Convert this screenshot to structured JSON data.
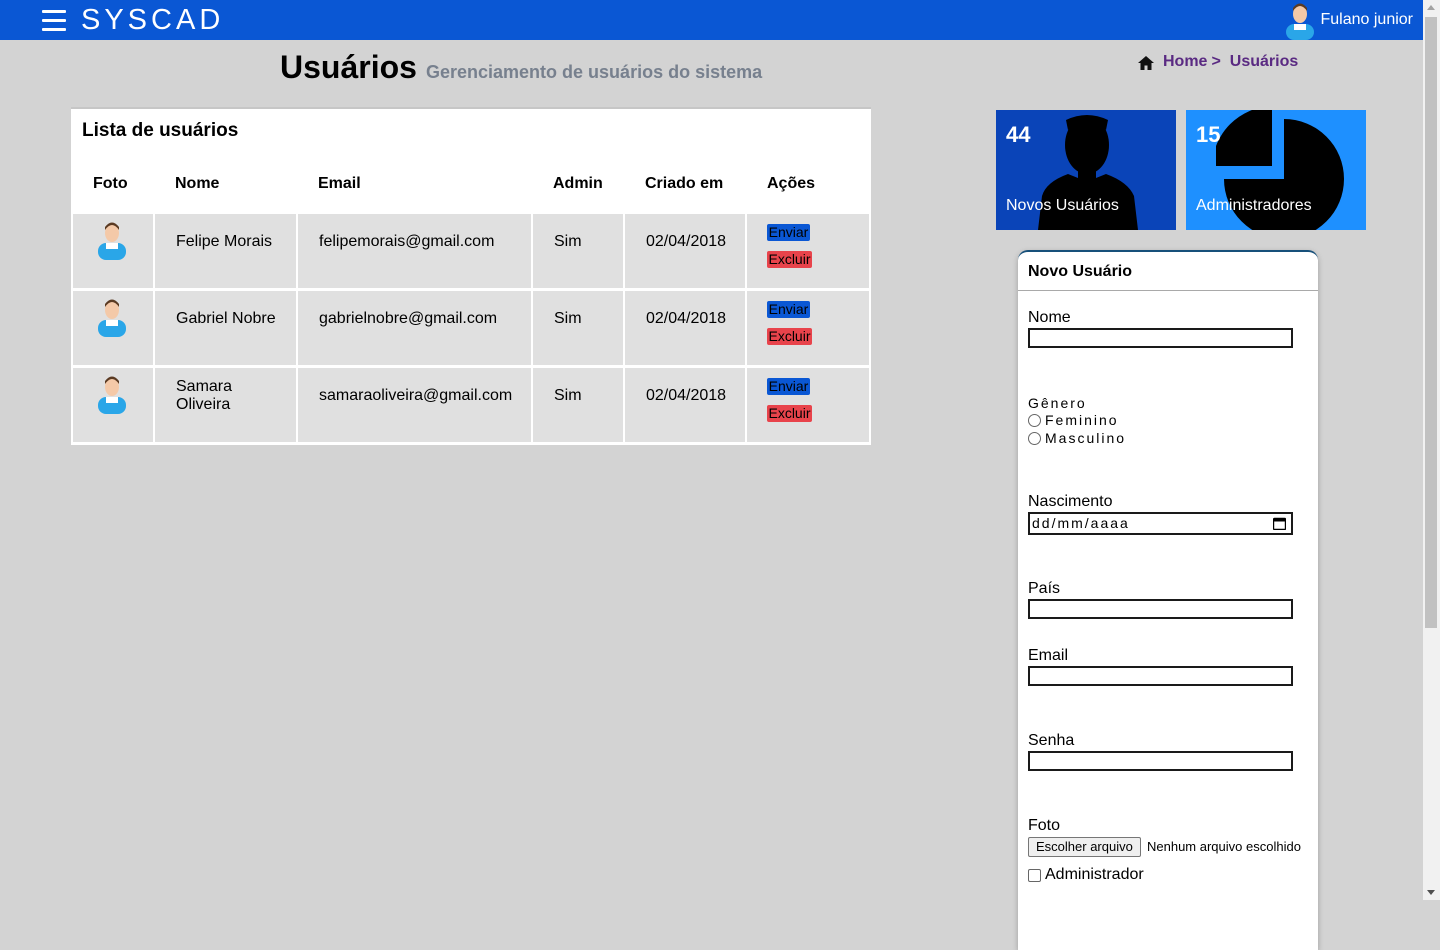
{
  "brand": "SYSCAD",
  "user": {
    "name": "Fulano junior"
  },
  "header": {
    "title": "Usuários",
    "subtitle": "Gerenciamento de usuários do sistema"
  },
  "breadcrumb": {
    "home": "Home",
    "separator": ">",
    "current": "Usuários"
  },
  "users_panel": {
    "title": "Lista de usuários",
    "columns": [
      "Foto",
      "Nome",
      "Email",
      "Admin",
      "Criado em",
      "Ações"
    ],
    "rows": [
      {
        "name": "Felipe Morais",
        "email": "felipemorais@gmail.com",
        "admin": "Sim",
        "created": "02/04/2018",
        "send": "Enviar",
        "delete": "Excluir"
      },
      {
        "name": "Gabriel Nobre",
        "email": "gabrielnobre@gmail.com",
        "admin": "Sim",
        "created": "02/04/2018",
        "send": "Enviar",
        "delete": "Excluir"
      },
      {
        "name": "Samara Oliveira",
        "email": "samaraoliveira@gmail.com",
        "admin": "Sim",
        "created": "02/04/2018",
        "send": "Enviar",
        "delete": "Excluir"
      }
    ]
  },
  "stats": [
    {
      "value": "44",
      "label": "Novos Usuários",
      "color": "#0a44b8",
      "icon": "user-silhouette-icon"
    },
    {
      "value": "15",
      "label": "Administradores",
      "color": "#1e90ff",
      "icon": "pie-chart-icon"
    }
  ],
  "form": {
    "title": "Novo Usuário",
    "nome_label": "Nome",
    "genero_label": "Gênero",
    "genero_options": [
      "Feminino",
      "Masculino"
    ],
    "nascimento_label": "Nascimento",
    "nascimento_placeholder": "dd/mm/aaaa",
    "pais_label": "País",
    "email_label": "Email",
    "senha_label": "Senha",
    "foto_label": "Foto",
    "file_button": "Escolher arquivo",
    "file_status": "Nenhum arquivo escolhido",
    "admin_label": "Administrador"
  },
  "colors": {
    "topbar": "#0a57d4",
    "send_button": "#0a57d4",
    "delete_button": "#e8434b",
    "breadcrumb": "#5a2a82"
  }
}
